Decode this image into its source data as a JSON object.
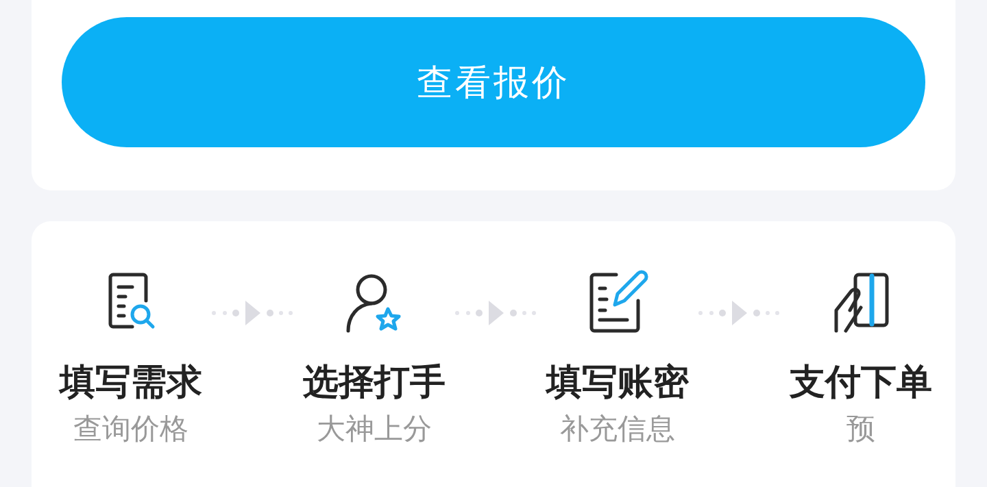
{
  "quote_button": {
    "label": "查看报价"
  },
  "steps": [
    {
      "kind": "search-doc",
      "title": "填写需求",
      "subtitle": "查询价格"
    },
    {
      "kind": "person-star",
      "title": "选择打手",
      "subtitle": "大神上分"
    },
    {
      "kind": "doc-pencil",
      "title": "填写账密",
      "subtitle": "补充信息"
    },
    {
      "kind": "hand-card",
      "title": "支付下单",
      "subtitle": "预"
    }
  ]
}
